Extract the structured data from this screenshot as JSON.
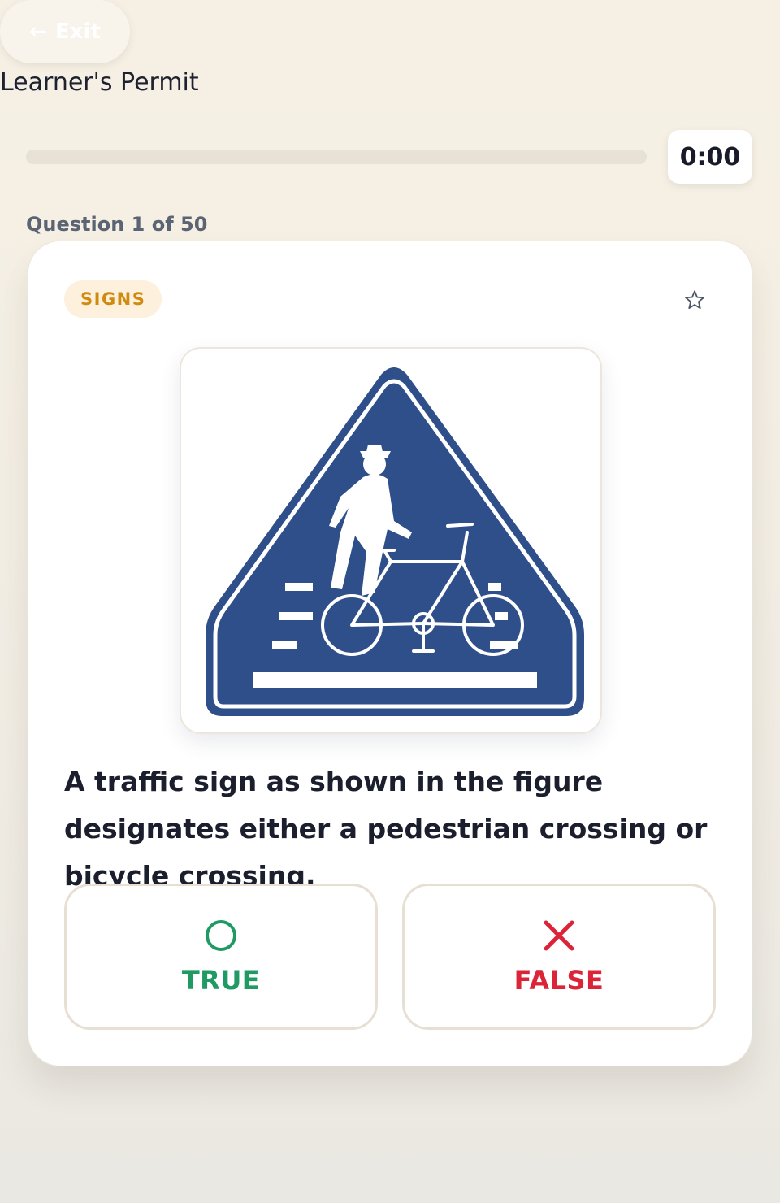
{
  "header": {
    "exit_label": "Exit",
    "app_title": "Learner's Permit"
  },
  "progress": {
    "value_percent": 0,
    "timer": "0:00"
  },
  "question": {
    "counter": "Question 1 of 50",
    "category": "SIGNS",
    "text": "A traffic sign as shown in the figure designates either a pedestrian crossing or bicycle crossing.",
    "image": "pedestrian-bicycle-crossing-sign",
    "bookmarked": false
  },
  "answers": {
    "true_label": "TRUE",
    "false_label": "FALSE",
    "true_icon": "circle-icon",
    "false_icon": "cross-icon"
  },
  "colors": {
    "accent_true": "#1f9a63",
    "accent_false": "#dc2439",
    "badge_text": "#d08a0f",
    "badge_bg": "#fdf0dc",
    "sign_blue": "#2f4f8a"
  }
}
